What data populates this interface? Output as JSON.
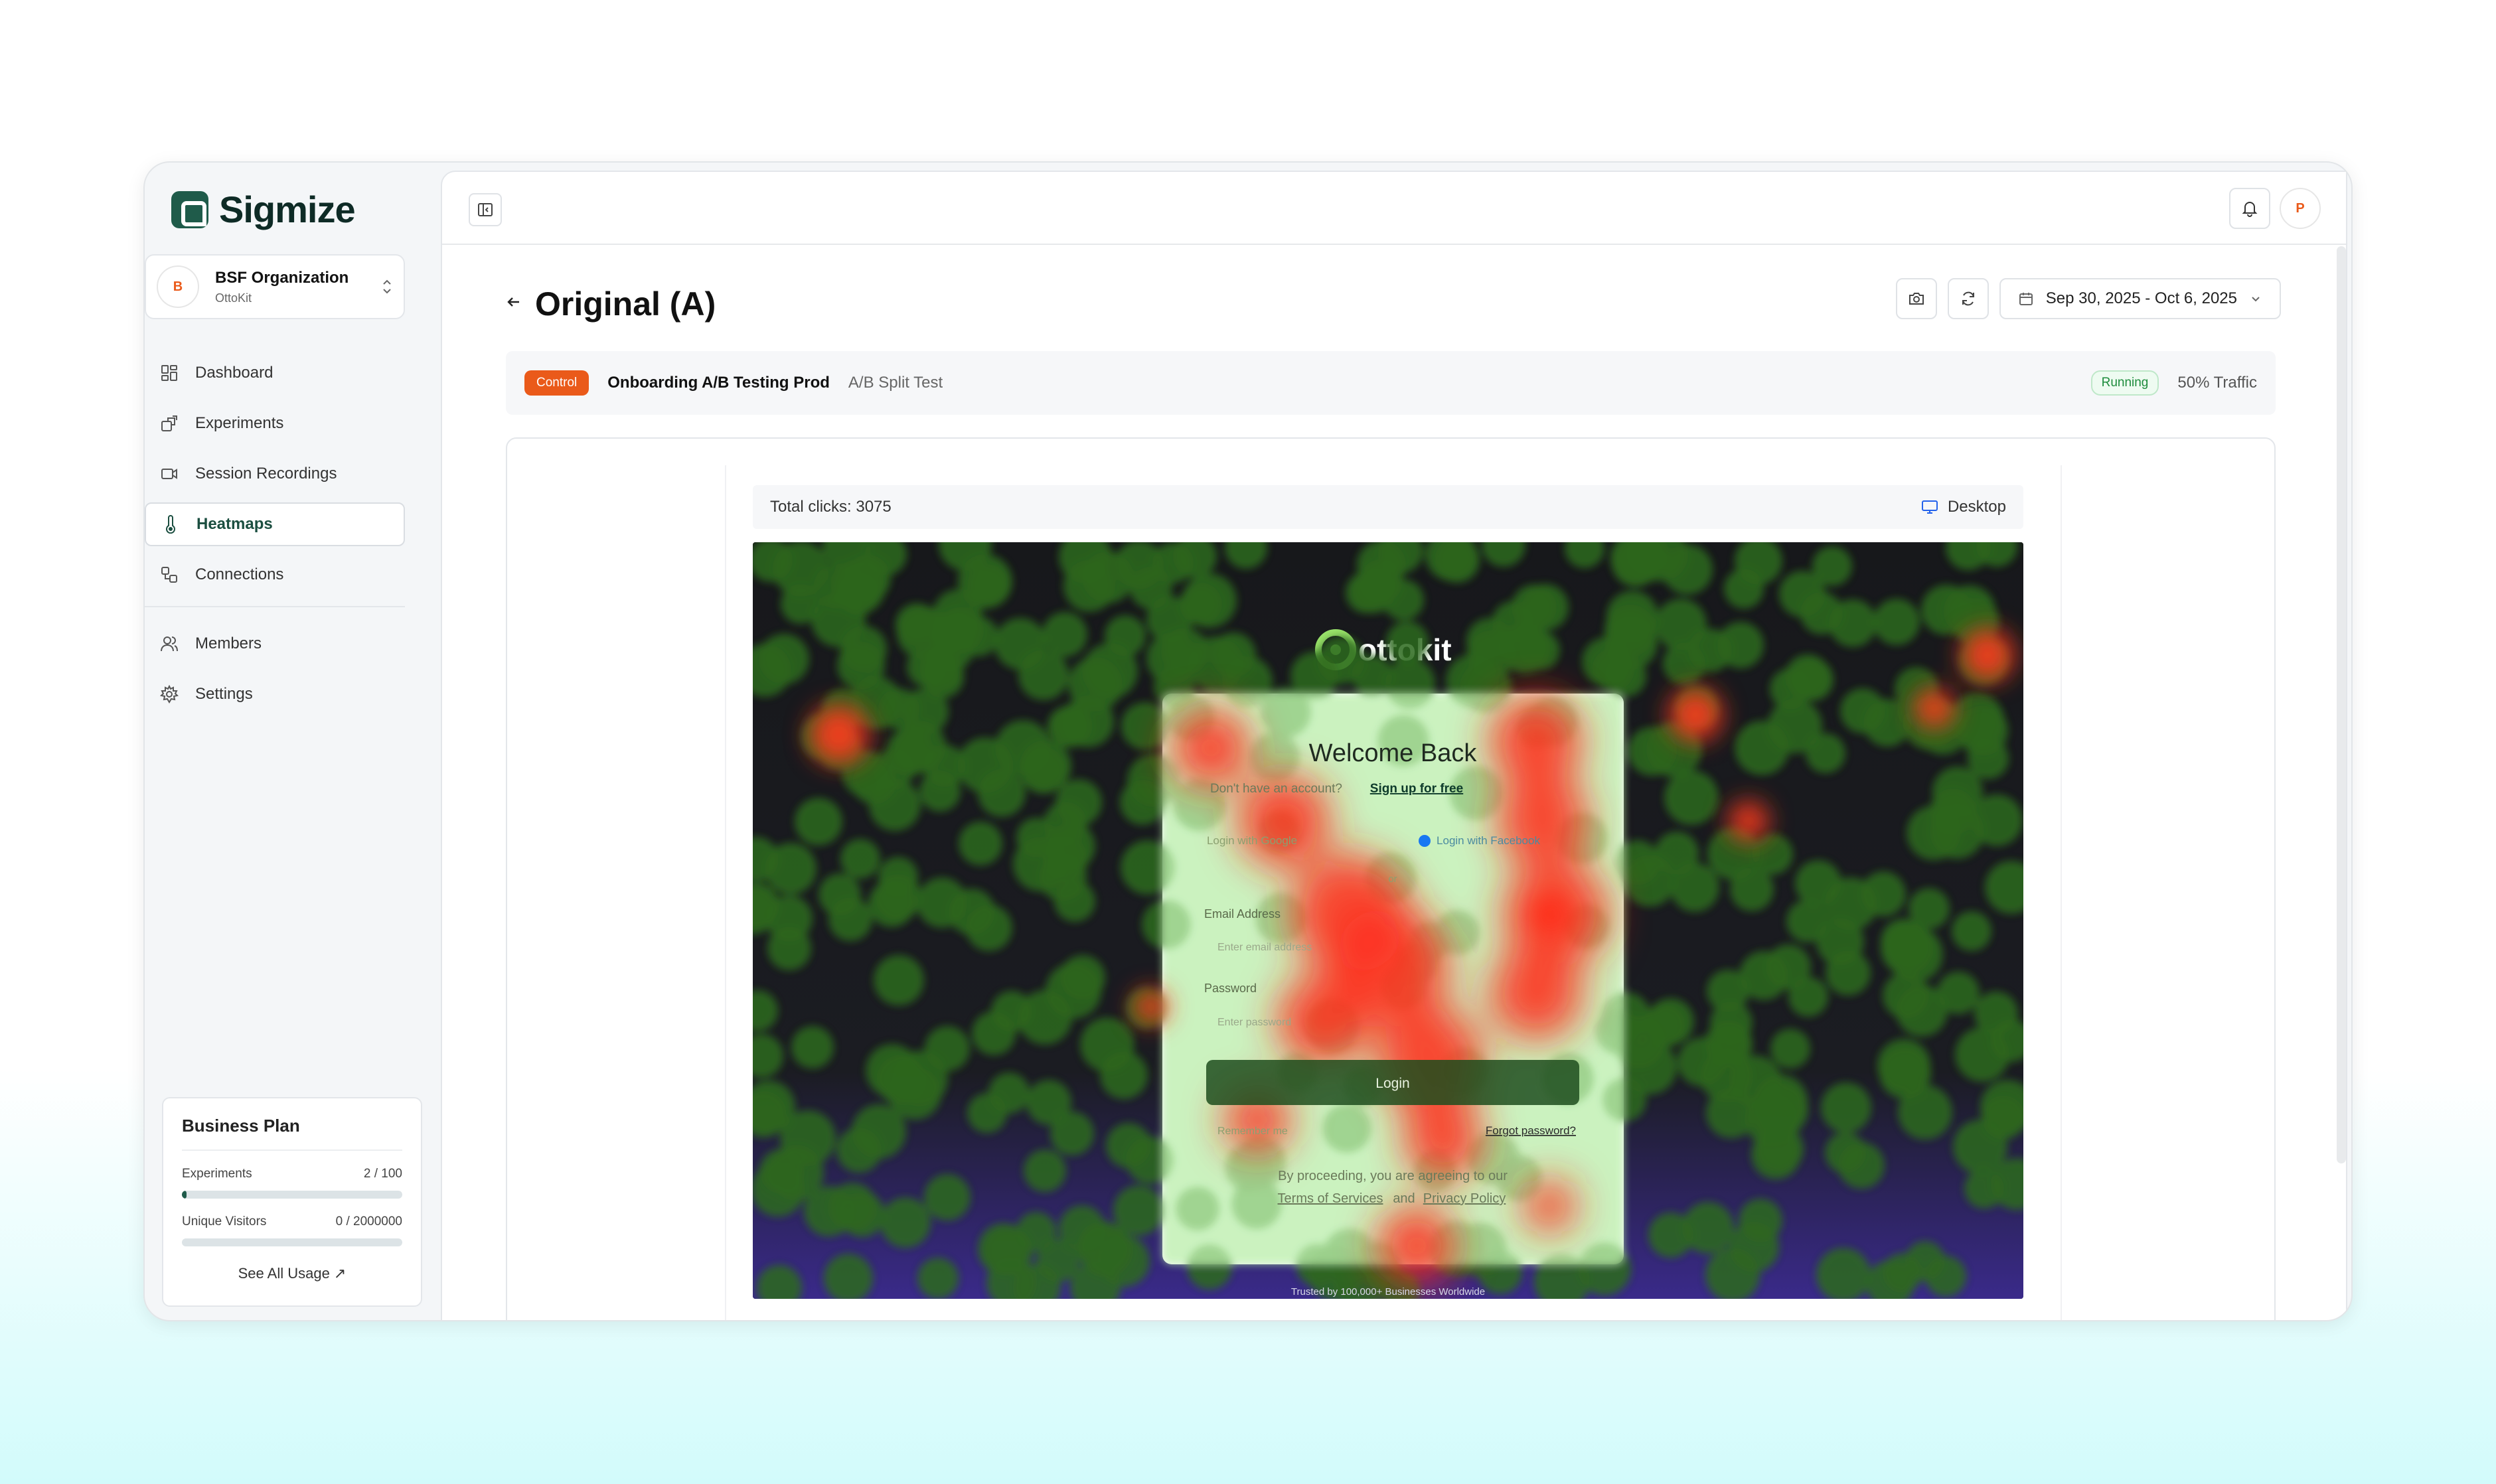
{
  "app": {
    "name": "Sigmize"
  },
  "org": {
    "name": "BSF Organization",
    "sub": "OttoKit",
    "initial": "B"
  },
  "nav": {
    "items": [
      {
        "label": "Dashboard",
        "icon": "dashboard-icon"
      },
      {
        "label": "Experiments",
        "icon": "experiments-icon"
      },
      {
        "label": "Session Recordings",
        "icon": "video-icon"
      },
      {
        "label": "Heatmaps",
        "icon": "thermometer-icon",
        "active": true
      },
      {
        "label": "Connections",
        "icon": "connections-icon"
      }
    ],
    "secondary": [
      {
        "label": "Members",
        "icon": "members-icon"
      },
      {
        "label": "Settings",
        "icon": "gear-icon"
      }
    ]
  },
  "plan": {
    "title": "Business Plan",
    "experiments_label": "Experiments",
    "experiments_value": "2 / 100",
    "experiments_fraction": 0.02,
    "visitors_label": "Unique Visitors",
    "visitors_value": "0 / 2000000",
    "visitors_fraction": 0,
    "link": "See All Usage ↗"
  },
  "user": {
    "initial": "P"
  },
  "page": {
    "title": "Original (A)",
    "date_range": "Sep 30, 2025 - Oct 6, 2025"
  },
  "variant": {
    "badge": "Control",
    "test_name": "Onboarding A/B Testing Prod",
    "test_type": "A/B Split Test",
    "status": "Running",
    "traffic": "50% Traffic"
  },
  "heatmap": {
    "total_clicks": "Total clicks: 3075",
    "device": "Desktop",
    "site": {
      "brand": "ottokit",
      "heading": "Welcome Back",
      "signup_prompt": "Don't have an account?",
      "signup_link": "Sign up for free",
      "google": "Login with Google",
      "facebook": "Login with Facebook",
      "or": "or",
      "email_label": "Email Address",
      "email_placeholder": "Enter email address",
      "password_label": "Password",
      "password_placeholder": "Enter password",
      "login": "Login",
      "remember": "Remember me",
      "forgot": "Forgot password?",
      "terms_prefix": "By proceeding, you are agreeing to our",
      "terms": "Terms of Services",
      "and": "and",
      "privacy": "Privacy Policy",
      "footer": "Trusted by 100,000+ Businesses Worldwide"
    }
  }
}
